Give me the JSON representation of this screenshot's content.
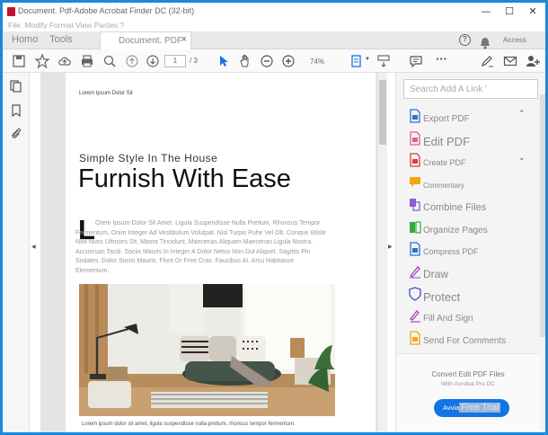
{
  "window": {
    "title": "Document. Pdf-Adobe Acrobat Finder DC (32-bit)",
    "controls": {
      "minimize": "—",
      "maximize": "☐",
      "close": "✕"
    }
  },
  "menu": {
    "text": "File. Modify Format View Parties ?"
  },
  "tabs": {
    "home": "Homo",
    "tools": "Tools",
    "document": "Document. PDF",
    "close": "×",
    "help": "?",
    "signin": "Access"
  },
  "toolbar": {
    "page_current": "1",
    "page_total": "/ 3",
    "zoom": "74%",
    "more": "···"
  },
  "document": {
    "small_heading": "Lorem Ipsum Dolor Sit",
    "subtitle": "Simple Style In The House",
    "headline": "Furnish With Ease",
    "drop_cap": "L",
    "body": "Orem Ipsum Dolor Sit Amet. Ligula Suspendisse Nulla Pretium, Rhoncus Tempor Fermentum, Onim Integer Ad Vestibulum Volutpat. Nisl Turpis Puhe Vel Olt. Conque Wisle NIM Nunc Ultricies Sit. Maora Tincidunt, Maecenas Aliquam Maecenas Ligula Nostra. Accumsan Taciti. Sociis Mauris In Integer A Dolor Netus Non Dul Aliquet. Sagittis Pin Sodales. Dolor Sociis Mauris. Flont Or Free Cras. Faucibus At. Arcu Habitasse Elementum.",
    "caption": "Lorem ipsum dolor sit amet, ligula suspendisse nulla pretium, rhoncus tempor fermentum."
  },
  "right_panel": {
    "search_placeholder": "Search Add A Link '",
    "tools": [
      {
        "label": "Export PDF",
        "color": "#2d6fd1",
        "size": 10,
        "chevron": "⌃"
      },
      {
        "label": "Edit PDF",
        "color": "#e45b8f",
        "size": 13
      },
      {
        "label": "Create PDF",
        "color": "#d93f3f",
        "size": 9,
        "chevron": "⌄"
      },
      {
        "label": "Commentary",
        "color": "#f2a60c",
        "size": 8
      },
      {
        "label": "Combine Files",
        "color": "#8a5cd6",
        "size": 11
      },
      {
        "label": "Organize Pages",
        "color": "#2faf3a",
        "size": 10
      },
      {
        "label": "Compress PDF",
        "color": "#2d6fd1",
        "size": 9
      },
      {
        "label": "Draw",
        "color": "#b03fc0",
        "size": 12
      },
      {
        "label": "Protect",
        "color": "#4b57c8",
        "size": 13
      },
      {
        "label": "Fill And Sign",
        "color": "#b03fc0",
        "size": 10
      },
      {
        "label": "Send For Comments",
        "color": "#f2a60c",
        "size": 10
      }
    ],
    "promo_line1": "Convert Edit PDF Files",
    "promo_line2": "With Acrobat Pro DC",
    "trial_prefix": "Avvia",
    "trial_label": "Free Trial"
  }
}
